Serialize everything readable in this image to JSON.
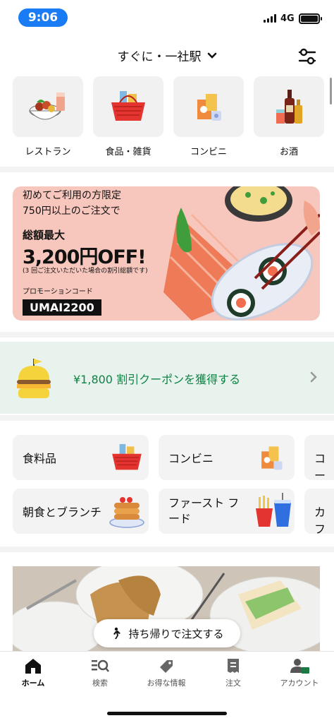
{
  "status_bar": {
    "time": "9:06",
    "network": "4G"
  },
  "header": {
    "location": "すぐに・一社駅"
  },
  "categories": [
    {
      "label": "レストラン",
      "icon": "restaurant-bowl-icon"
    },
    {
      "label": "食品・雑貨",
      "icon": "grocery-basket-icon"
    },
    {
      "label": "コンビニ",
      "icon": "convenience-store-icon"
    },
    {
      "label": "お酒",
      "icon": "liquor-bottles-icon"
    }
  ],
  "promo": {
    "line1": "初めてご利用の方限定",
    "line2": "750円以上のご注文で",
    "line3": "総額最大",
    "line4": "3,200円OFF!",
    "line5": "(3 回ご注文いただいた場合の割引総額です)",
    "code_label": "プロモーションコード",
    "code": "UMAI2200"
  },
  "coupon": {
    "text": "¥1,800 割引クーポンを獲得する"
  },
  "shortcuts": [
    {
      "label": "食料品",
      "icon": "grocery-basket-icon"
    },
    {
      "label": "コンビニ",
      "icon": "convenience-store-icon"
    },
    {
      "label": "コー",
      "icon": ""
    },
    {
      "label": "朝食とブランチ",
      "icon": "pancake-icon"
    },
    {
      "label": "ファースト フード",
      "label_line1": "ファースト フ",
      "label_line2": "ード",
      "icon": "fast-food-icon"
    },
    {
      "label": "カフ",
      "icon": ""
    }
  ],
  "takeout_button": {
    "label": "持ち帰りで注文する"
  },
  "tabs": [
    {
      "label": "ホーム",
      "icon": "home-icon",
      "active": true
    },
    {
      "label": "検索",
      "icon": "search-icon",
      "active": false
    },
    {
      "label": "お得な情報",
      "icon": "tag-icon",
      "active": false
    },
    {
      "label": "注文",
      "icon": "receipt-icon",
      "active": false
    },
    {
      "label": "アカウント",
      "icon": "account-icon",
      "active": false
    }
  ],
  "colors": {
    "accent_blue": "#1a7cf5",
    "coupon_green": "#0e8345",
    "coupon_bg": "#e7f3ec",
    "promo_bg": "#f7c6bc"
  }
}
